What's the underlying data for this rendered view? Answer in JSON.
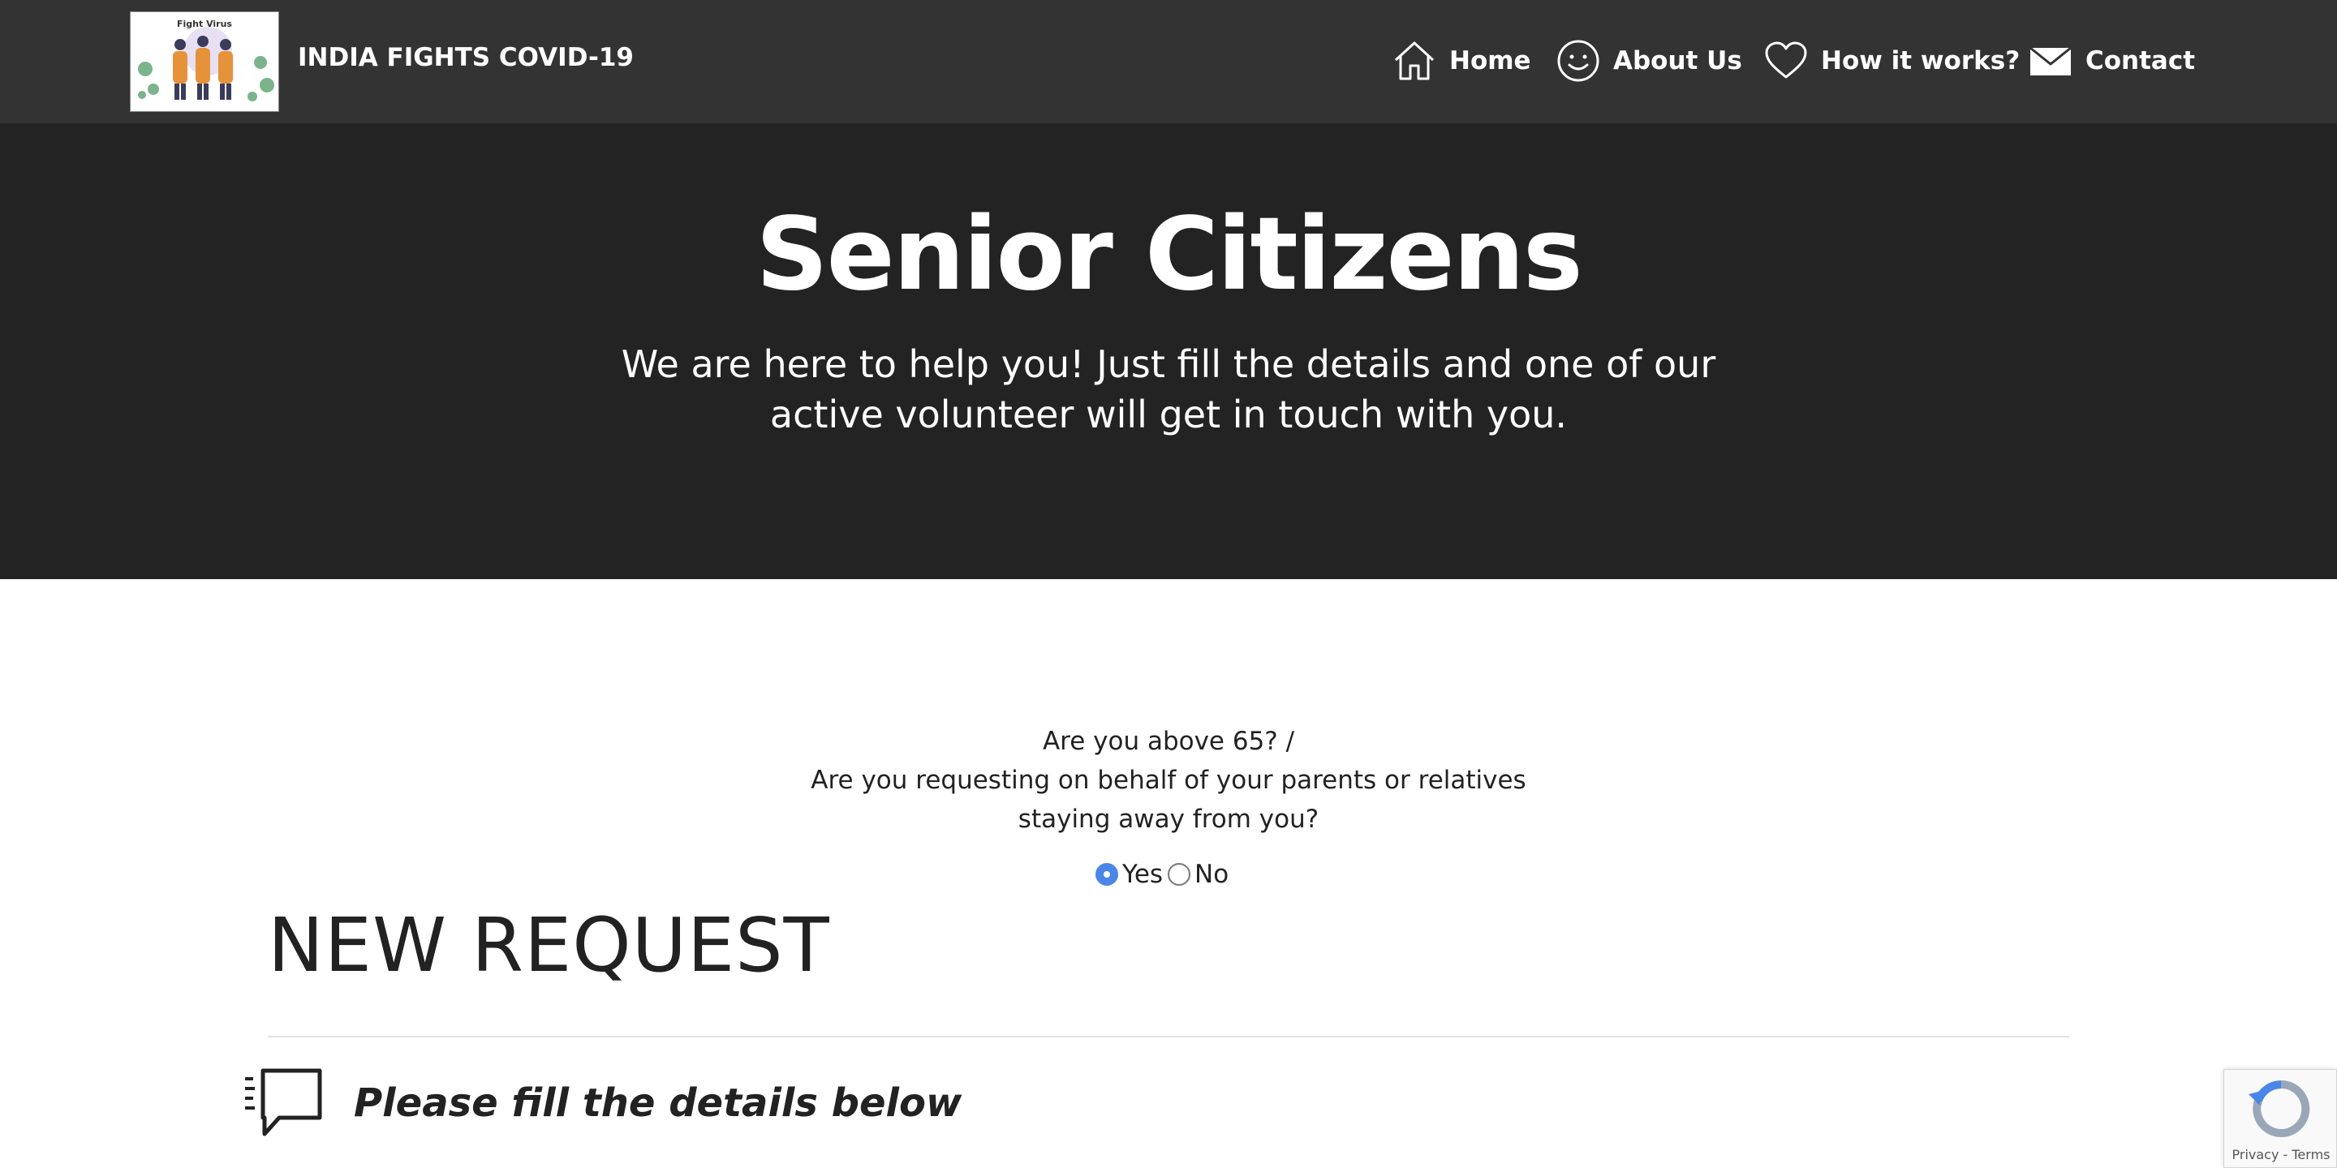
{
  "brand": {
    "name": "INDIA FIGHTS COVID-19",
    "logo_text": "Fight Virus"
  },
  "nav": {
    "items": [
      {
        "label": "Home",
        "icon": "home-icon"
      },
      {
        "label": "About Us",
        "icon": "smiley-icon"
      },
      {
        "label": "How it works?",
        "icon": "heart-icon"
      },
      {
        "label": "Contact",
        "icon": "envelope-icon"
      }
    ]
  },
  "hero": {
    "title": "Senior Citizens",
    "subtitle": "We are here to help you! Just fill the details and one of our active volunteer will get in touch with you."
  },
  "question": {
    "line1": "Are you above 65? /",
    "line2": "Are you requesting on behalf of your parents or relatives",
    "line3": "staying away from you?",
    "options": [
      {
        "label": "Yes",
        "checked": true
      },
      {
        "label": "No",
        "checked": false
      }
    ]
  },
  "form": {
    "section_title": "NEW REQUEST",
    "details_prompt": "Please fill the details below"
  },
  "recaptcha": {
    "links": "Privacy - Terms"
  },
  "colors": {
    "navbar": "#333333",
    "hero": "#232323",
    "radio_accent": "#4a86e8"
  }
}
